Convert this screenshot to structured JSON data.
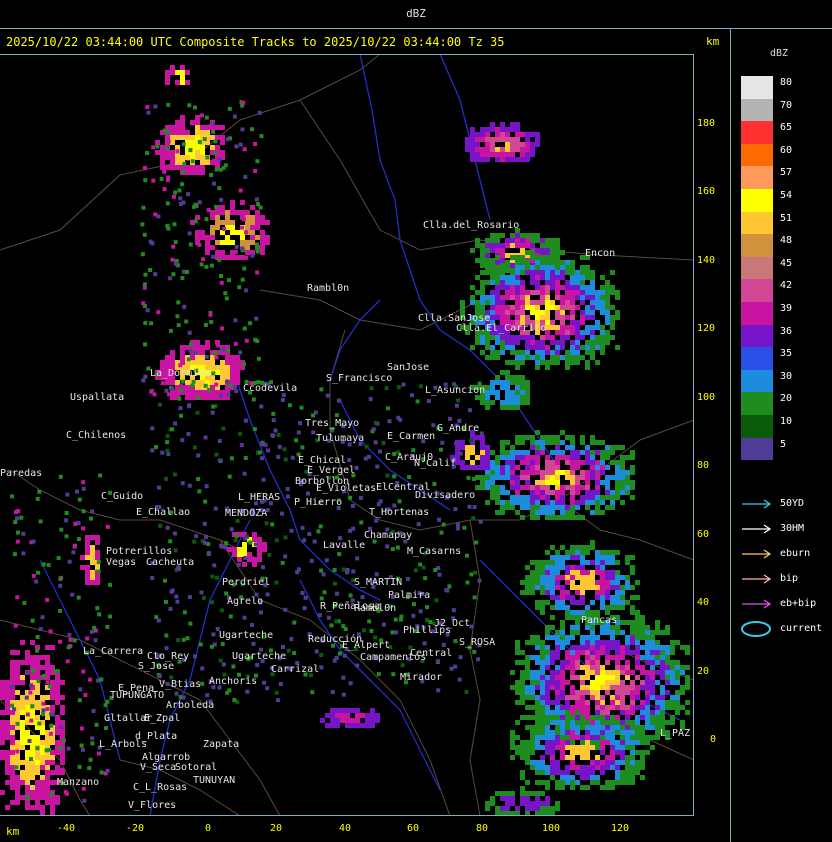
{
  "window": {
    "title": "dBZ"
  },
  "header": {
    "text": "2025/10/22 03:44:00 UTC Composite Tracks to 2025/10/22 03:44:00 Tz 35",
    "km_top": "km",
    "km_bottom": "km"
  },
  "axes": {
    "y_ticks": [
      "180",
      "160",
      "140",
      "120",
      "100",
      "80",
      "60",
      "40",
      "20",
      "0"
    ],
    "x_ticks": [
      "-40",
      "-20",
      "0",
      "20",
      "40",
      "60",
      "80",
      "100",
      "120"
    ]
  },
  "legend": {
    "title": "dBZ",
    "levels": [
      {
        "label": "80",
        "color": "#e6e6e6"
      },
      {
        "label": "70",
        "color": "#b4b4b4"
      },
      {
        "label": "65",
        "color": "#ff3030"
      },
      {
        "label": "60",
        "color": "#ff6a00"
      },
      {
        "label": "57",
        "color": "#ff9a5a"
      },
      {
        "label": "54",
        "color": "#ffff00"
      },
      {
        "label": "51",
        "color": "#ffc832"
      },
      {
        "label": "48",
        "color": "#d2913c"
      },
      {
        "label": "45",
        "color": "#c87878"
      },
      {
        "label": "42",
        "color": "#d24696"
      },
      {
        "label": "39",
        "color": "#c814a0"
      },
      {
        "label": "36",
        "color": "#7814c8"
      },
      {
        "label": "35",
        "color": "#2850e6"
      },
      {
        "label": "30",
        "color": "#1e8cdc"
      },
      {
        "label": "20",
        "color": "#1e8c1e"
      },
      {
        "label": "10",
        "color": "#0a5a0a"
      },
      {
        "label": "5",
        "color": "#503c96"
      }
    ],
    "tracks": [
      {
        "label": "50YD",
        "color": "#3cc8e6"
      },
      {
        "label": "30HM",
        "color": "#ffffff"
      },
      {
        "label": "eburn",
        "color": "#ffc864"
      },
      {
        "label": "bip",
        "color": "#ffb4b4"
      },
      {
        "label": "eb+bip",
        "color": "#e650e6"
      },
      {
        "label": "current",
        "color": "#3cc8e6"
      }
    ]
  },
  "places": [
    "Clla.del_Rosario",
    "Encon",
    "Rambl0n",
    "Clla.SanJose",
    "Clla.El_Carrito",
    "S_Francisco",
    "SanJose",
    "Ccodevila",
    "L_Asuncion",
    "Uspallata",
    "Tres_Mayo",
    "Tulumaya",
    "E_Carmen",
    "G_Andre",
    "C_Chilenos",
    "E_Chical",
    "E_Vergel",
    "C_Arauj0",
    "Borbollon",
    "E_Violetas",
    "ElCentral",
    "Divisadero",
    "C_Guido",
    "P_Hierro",
    "L_HERAS",
    "E_Challao",
    "T_Hortenas",
    "Chamapay",
    "Lavalle",
    "Potrerillos",
    "Vegas",
    "Cacheuta",
    "M_Casarns",
    "S_MARTIN",
    "Palmira",
    "Perdriel",
    "Agrelo",
    "R_Peñalosa",
    "Rambl0n",
    "Ugarteche",
    "J2_Oct",
    "Phillips",
    "S_ROSA",
    "La_Carrera",
    "Cto_Rey",
    "S_Jose",
    "Reducción",
    "E_Alpert",
    "Campamentos",
    "Central",
    "Carrizal",
    "Anchoris",
    "V_Btias",
    "E_Pena",
    "TUPUNGATO",
    "Mirador",
    "Arboleda",
    "Gltallar",
    "E_Zpal",
    "d_Plata",
    "L_Arbols",
    "Zapata",
    "Algarrob",
    "V_Seca",
    "Sotoral",
    "TUNUYAN",
    "C_L_Rosas",
    "Manzano",
    "V_Flores",
    "L_PAZ",
    "La_Dormida",
    "N_Calif",
    "Pancas",
    "Paredas",
    "MENDOZA",
    "Ugarteche"
  ]
}
